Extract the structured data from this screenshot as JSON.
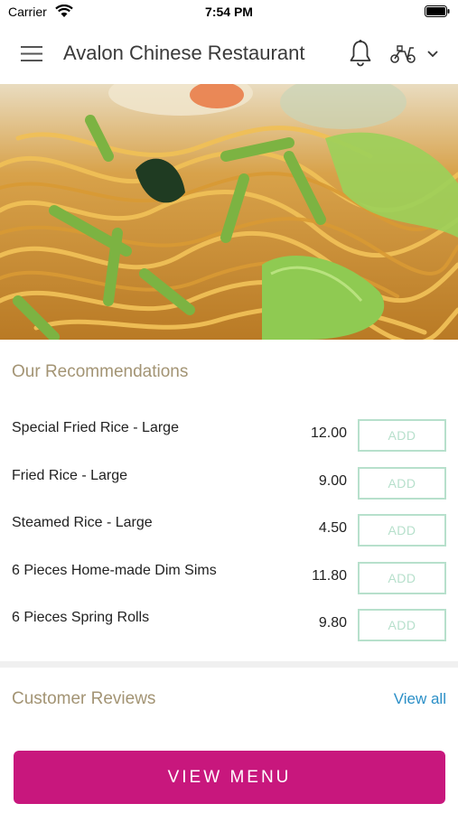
{
  "status_bar": {
    "carrier": "Carrier",
    "time": "7:54 PM"
  },
  "header": {
    "title": "Avalon Chinese Restaurant"
  },
  "recommendations": {
    "title": "Our Recommendations",
    "add_label": "ADD",
    "items": [
      {
        "name": "Special Fried Rice - Large",
        "price": "12.00"
      },
      {
        "name": "Fried Rice - Large",
        "price": "9.00"
      },
      {
        "name": "Steamed Rice - Large",
        "price": "4.50"
      },
      {
        "name": "6 Pieces Home-made Dim Sims",
        "price": "11.80"
      },
      {
        "name": "6 Pieces Spring Rolls",
        "price": "9.80"
      }
    ]
  },
  "reviews": {
    "title": "Customer Reviews",
    "view_all": "View all"
  },
  "footer": {
    "view_menu": "VIEW MENU"
  },
  "colors": {
    "brand_pink": "#c8177d",
    "add_border": "#b7e0cc",
    "section_title": "#a39474",
    "link_blue": "#2b8fc7"
  },
  "icons": {
    "menu": "hamburger-menu-icon",
    "notifications": "bell-icon",
    "delivery": "scooter-icon",
    "dropdown": "chevron-down-icon",
    "wifi": "wifi-icon",
    "battery": "battery-icon"
  }
}
